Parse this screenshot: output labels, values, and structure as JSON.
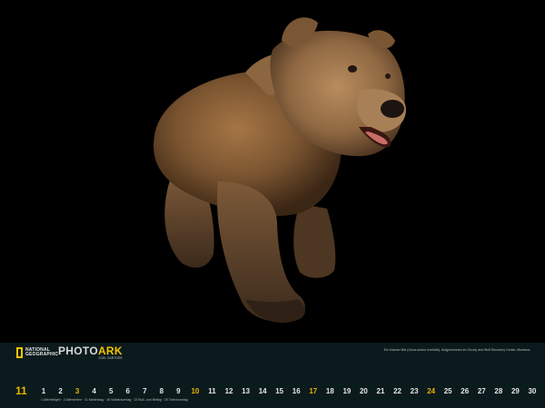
{
  "brand": {
    "publisher_line1": "NATIONAL",
    "publisher_line2": "GEOGRAPHIC",
    "series_prefix": "PHOTO",
    "series_suffix": "ARK",
    "photographer": "JOEL SARTORE"
  },
  "caption": "Ein brauner Bär (Ursus arctos horribilis). Aufgenommen im Grizzly and Wolf Discovery Center, Montana.",
  "month": {
    "number": "11"
  },
  "days": [
    {
      "label": "1",
      "highlight": false
    },
    {
      "label": "2",
      "highlight": false
    },
    {
      "label": "3",
      "highlight": true
    },
    {
      "label": "4",
      "highlight": false
    },
    {
      "label": "5",
      "highlight": false
    },
    {
      "label": "6",
      "highlight": false
    },
    {
      "label": "7",
      "highlight": false
    },
    {
      "label": "8",
      "highlight": false
    },
    {
      "label": "9",
      "highlight": false
    },
    {
      "label": "10",
      "highlight": true
    },
    {
      "label": "11",
      "highlight": false
    },
    {
      "label": "12",
      "highlight": false
    },
    {
      "label": "13",
      "highlight": false
    },
    {
      "label": "14",
      "highlight": false
    },
    {
      "label": "15",
      "highlight": false
    },
    {
      "label": "16",
      "highlight": false
    },
    {
      "label": "17",
      "highlight": true
    },
    {
      "label": "18",
      "highlight": false
    },
    {
      "label": "19",
      "highlight": false
    },
    {
      "label": "20",
      "highlight": false
    },
    {
      "label": "21",
      "highlight": false
    },
    {
      "label": "22",
      "highlight": false
    },
    {
      "label": "23",
      "highlight": false
    },
    {
      "label": "24",
      "highlight": true
    },
    {
      "label": "25",
      "highlight": false
    },
    {
      "label": "26",
      "highlight": false
    },
    {
      "label": "27",
      "highlight": false
    },
    {
      "label": "28",
      "highlight": false
    },
    {
      "label": "29",
      "highlight": false
    },
    {
      "label": "30",
      "highlight": false
    }
  ],
  "holiday_note": "1 Allerheiligen · 2 Allerseelen · 11 Martinstag · 18 Volkstrauertag · 22 Buß- und Bettag · 25 Totensonntag",
  "colors": {
    "accent": "#e8b400",
    "footer_bg": "#0b1a1c",
    "background": "#000000"
  },
  "icons": {
    "logo": "yellow-rectangle-logo",
    "photo_subject": "grizzly-bear"
  }
}
